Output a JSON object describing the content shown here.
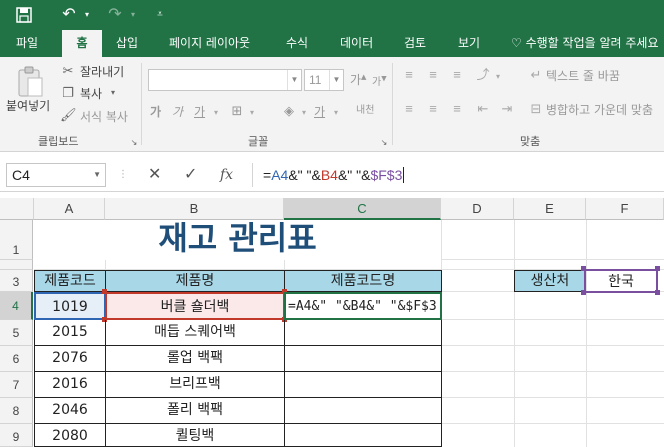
{
  "qat": {
    "save_icon": "save-icon",
    "undo_icon": "undo-icon",
    "redo_icon": "redo-icon",
    "customize_icon": "customize-qat-icon"
  },
  "tabs": [
    "파일",
    "홈",
    "삽입",
    "페이지 레이아웃",
    "수식",
    "데이터",
    "검토",
    "보기"
  ],
  "tell_me": "수행할 작업을 알려 주세요",
  "ribbon": {
    "clipboard": {
      "paste": "붙여넣기",
      "cut": "잘라내기",
      "copy": "복사",
      "format_painter": "서식 복사",
      "group": "클립보드"
    },
    "font": {
      "name": "",
      "size": "11",
      "group": "글꼴",
      "bold": "가",
      "italic": "가",
      "underline": "가",
      "grow": "가",
      "shrink": "가",
      "phonetic": "내천"
    },
    "alignment": {
      "wrap": "텍스트 줄 바꿈",
      "merge": "병합하고 가운데 맞춤",
      "group": "맞춤"
    }
  },
  "formula_bar": {
    "name_box": "C4",
    "cancel": "✕",
    "enter": "✓",
    "fx": "fx",
    "parts": [
      "=",
      "A4",
      "&\" \"&",
      "B4",
      "&\" \"&",
      "$F$3"
    ]
  },
  "columns": [
    "A",
    "B",
    "C",
    "D",
    "E",
    "F"
  ],
  "rows": [
    "1",
    "",
    "3",
    "4",
    "5",
    "6",
    "7",
    "8",
    "9"
  ],
  "sheet": {
    "title": "재고 관리표",
    "headers": [
      "제품코드",
      "제품명",
      "제품코드명"
    ],
    "data": [
      {
        "code": "1019",
        "name": "버클 숄더백",
        "codename": "=A4&\" \"&B4&\" \"&$F$3"
      },
      {
        "code": "2015",
        "name": "매듭 스퀘어백",
        "codename": ""
      },
      {
        "code": "2076",
        "name": "롤업 백팩",
        "codename": ""
      },
      {
        "code": "2016",
        "name": "브리프백",
        "codename": ""
      },
      {
        "code": "2046",
        "name": "폴리 백팩",
        "codename": ""
      },
      {
        "code": "2080",
        "name": "퀼팅백",
        "codename": ""
      }
    ],
    "origin_label": "생산처",
    "origin_value": "한국"
  },
  "colors": {
    "excel_green": "#217346",
    "header_fill": "#a8d8e8",
    "ref_a": "#2f66b3",
    "ref_b": "#c0392b",
    "ref_c": "#7a4fa0"
  }
}
